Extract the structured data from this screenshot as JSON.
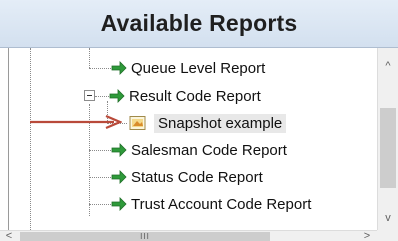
{
  "panel": {
    "title": "Available Reports"
  },
  "tree": {
    "nodes": [
      {
        "label": "Queue Level Report",
        "icon": "report-arrow-icon"
      },
      {
        "label": "Result Code Report",
        "icon": "report-arrow-icon",
        "expanded": true
      },
      {
        "label": "Snapshot example",
        "icon": "snapshot-icon",
        "selected": true
      },
      {
        "label": "Salesman Code Report",
        "icon": "report-arrow-icon"
      },
      {
        "label": "Status Code Report",
        "icon": "report-arrow-icon"
      },
      {
        "label": "Trust Account Code Report",
        "icon": "report-arrow-icon"
      }
    ]
  },
  "scrollbars": {
    "up_glyph": "^",
    "down_glyph": "v",
    "left_glyph": "<",
    "right_glyph": ">",
    "grip_glyph": "III"
  },
  "colors": {
    "header_bg": "#dbe6f3",
    "icon_green": "#2e9a3a",
    "arrow_red": "#b94a3a",
    "selection_bg": "#e8e8e8"
  }
}
